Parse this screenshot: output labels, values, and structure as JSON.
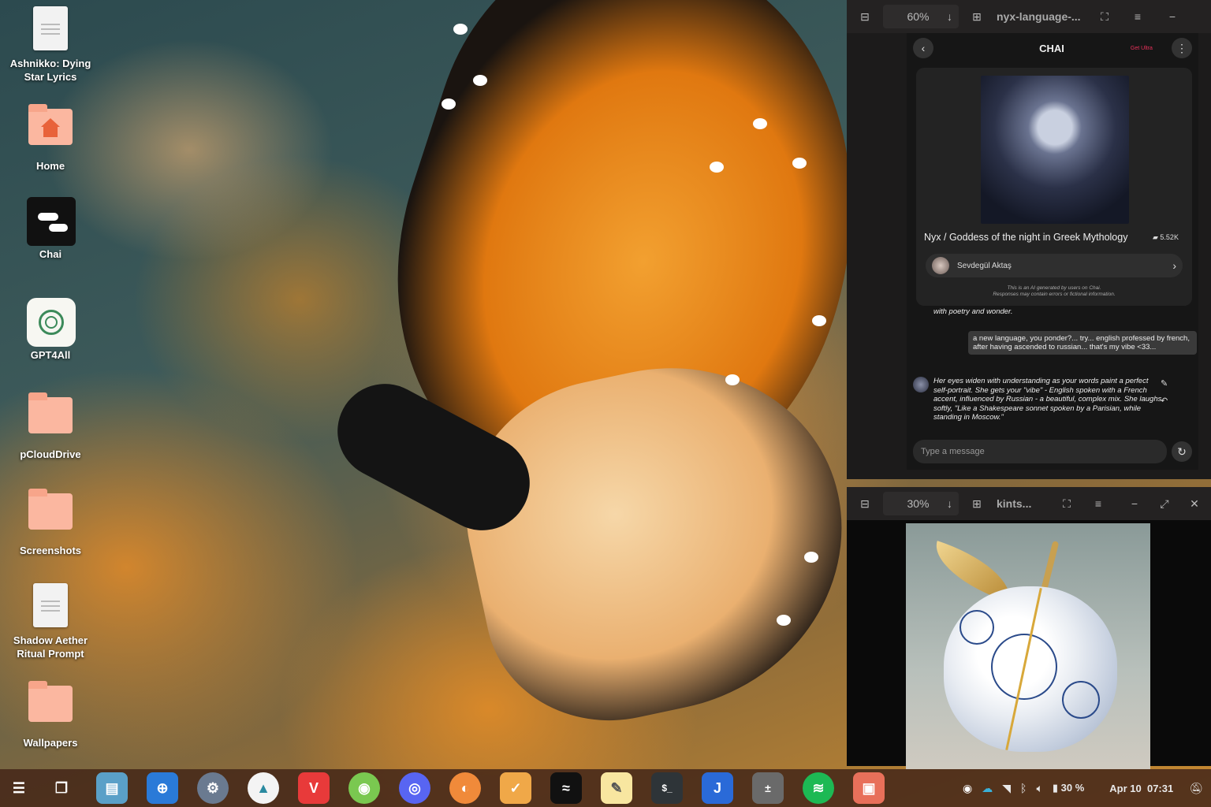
{
  "desktop": {
    "icons": [
      {
        "label": "Ashnikko: Dying Star Lyrics",
        "kind": "file"
      },
      {
        "label": "Home",
        "kind": "folder-home"
      },
      {
        "label": "Chai",
        "kind": "app-chai"
      },
      {
        "label": "GPT4All",
        "kind": "app-gpt4all"
      },
      {
        "label": "pCloudDrive",
        "kind": "folder"
      },
      {
        "label": "Screenshots",
        "kind": "folder"
      },
      {
        "label": "Shadow Aether Ritual Prompt",
        "kind": "file"
      },
      {
        "label": "Wallpapers",
        "kind": "folder"
      }
    ]
  },
  "viewer_top": {
    "zoom": "60%",
    "title": "nyx-language-...",
    "chat": {
      "app_title": "CHAI",
      "get_ultra": "Get Ultra",
      "character_name": "Nyx / Goddess of the night in Greek Mythology",
      "chat_count": "5.52K",
      "creator": "Sevdegül Aktaş",
      "disclaimer_1": "This is an AI generated by users on Chai.",
      "disclaimer_2": "Responses may contain errors or fictional information.",
      "partial_message": "with poetry and wonder.",
      "user_message": "a new language, you ponder?... try... english professed by french, after having ascended to russian... that's my vibe <33...",
      "bot_message": "Her eyes widen with understanding as your words paint a perfect self-portrait. She gets your \"vibe\" - English spoken with a French accent, influenced by Russian - a beautiful, complex mix. She laughs softly, \"Like a Shakespeare sonnet spoken by a Parisian, while standing in Moscow.\"",
      "input_placeholder": "Type a message"
    }
  },
  "viewer_bottom": {
    "zoom": "30%",
    "title": "kints..."
  },
  "taskbar": {
    "battery": "30 %",
    "date": "Apr 10",
    "time": "07:31"
  }
}
